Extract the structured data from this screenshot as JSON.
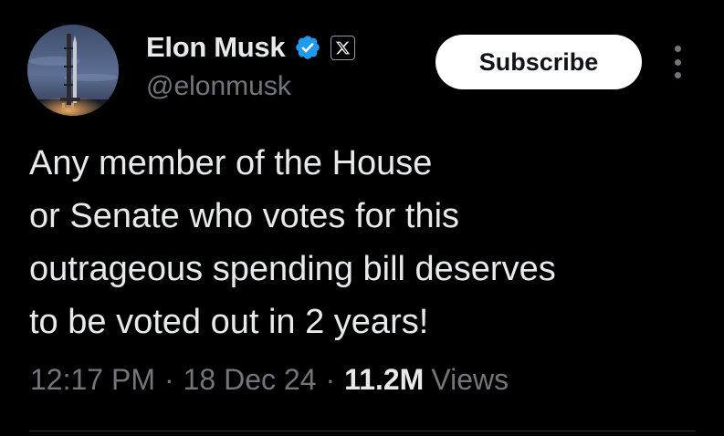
{
  "author": {
    "display_name": "Elon Musk",
    "handle": "@elonmusk",
    "verified_icon": "verified-badge-icon",
    "affiliate_icon": "x-logo-icon"
  },
  "actions": {
    "subscribe_label": "Subscribe",
    "more_icon": "more-vertical-icon"
  },
  "tweet": {
    "text": "Any member of the House\nor Senate who votes for this\noutrageous spending bill deserves\nto be voted out in 2 years!"
  },
  "meta": {
    "time": "12:17 PM",
    "separator": "·",
    "date": "18 Dec 24",
    "views_count": "11.2M",
    "views_label": "Views"
  },
  "colors": {
    "background": "#000000",
    "text_primary": "#e7e9ea",
    "text_secondary": "#71767b",
    "verified_blue": "#1d9bf0",
    "button_bg": "#ffffff"
  }
}
